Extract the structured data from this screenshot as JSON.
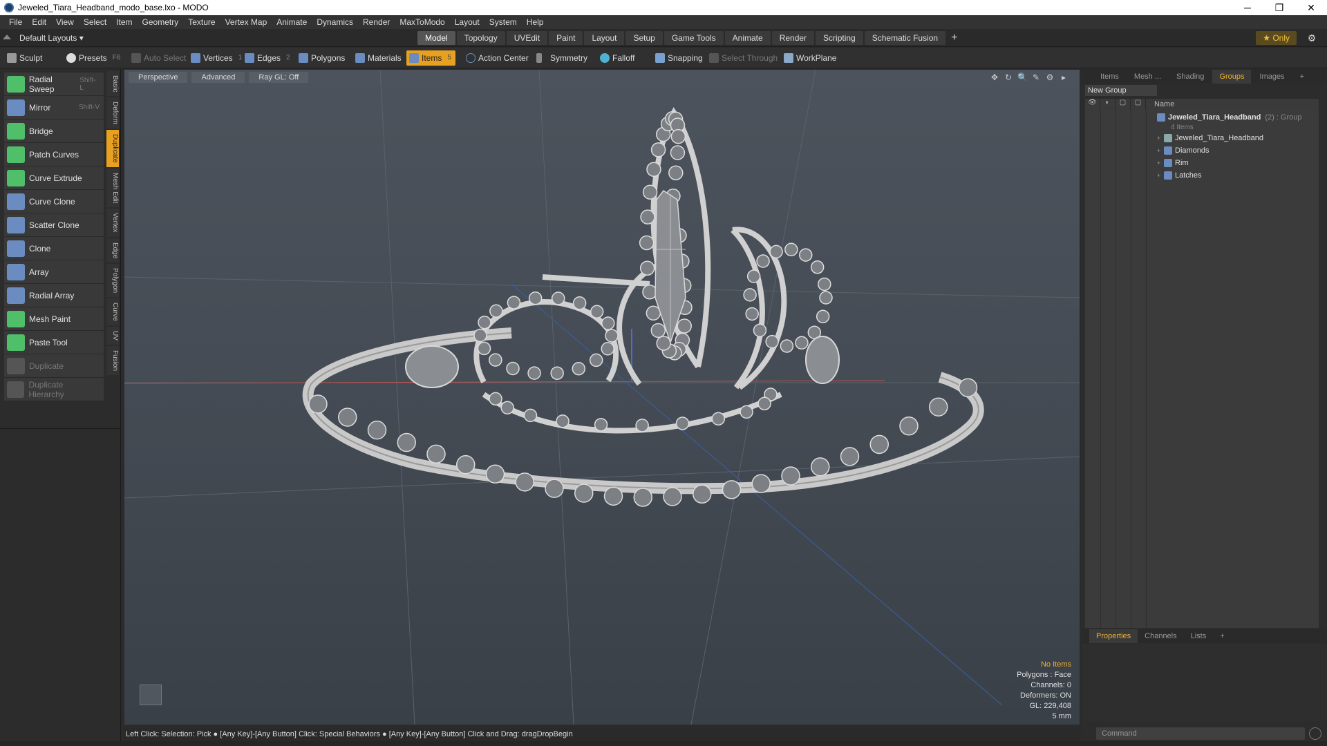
{
  "window": {
    "title": "Jeweled_Tiara_Headband_modo_base.lxo - MODO",
    "controls": [
      "─",
      "❐",
      "✕"
    ]
  },
  "menu": [
    "File",
    "Edit",
    "View",
    "Select",
    "Item",
    "Geometry",
    "Texture",
    "Vertex Map",
    "Animate",
    "Dynamics",
    "Render",
    "MaxToModo",
    "Layout",
    "System",
    "Help"
  ],
  "layout": {
    "selector": "Default Layouts ▾",
    "tabs": [
      "Model",
      "Topology",
      "UVEdit",
      "Paint",
      "Layout",
      "Setup",
      "Game Tools",
      "Animate",
      "Render",
      "Scripting",
      "Schematic Fusion"
    ],
    "active_tab": "Model",
    "plus": "+",
    "only": "★ Only",
    "gear": "⚙"
  },
  "toolbar": {
    "sculpt": "Sculpt",
    "presets": "Presets",
    "presets_key": "F6",
    "auto_select": "Auto Select",
    "vertices": "Vertices",
    "vertices_num": "1",
    "edges": "Edges",
    "edges_num": "2",
    "polygons": "Polygons",
    "materials": "Materials",
    "items": "Items",
    "items_num": "5",
    "action_center": "Action Center",
    "symmetry": "Symmetry",
    "falloff": "Falloff",
    "snapping": "Snapping",
    "select_through": "Select Through",
    "workplane": "WorkPlane"
  },
  "tools": [
    {
      "label": "Radial Sweep",
      "shortcut": "Shift-L",
      "color": "#4fbf6a"
    },
    {
      "label": "Mirror",
      "shortcut": "Shift-V",
      "color": "#6a8cc0"
    },
    {
      "label": "Bridge",
      "shortcut": "",
      "color": "#4fbf6a"
    },
    {
      "label": "Patch Curves",
      "shortcut": "",
      "color": "#4fbf6a"
    },
    {
      "label": "Curve Extrude",
      "shortcut": "",
      "color": "#4fbf6a"
    },
    {
      "label": "Curve Clone",
      "shortcut": "",
      "color": "#6a8cc0"
    },
    {
      "label": "Scatter Clone",
      "shortcut": "",
      "color": "#6a8cc0"
    },
    {
      "label": "Clone",
      "shortcut": "",
      "color": "#6a8cc0"
    },
    {
      "label": "Array",
      "shortcut": "",
      "color": "#6a8cc0"
    },
    {
      "label": "Radial Array",
      "shortcut": "",
      "color": "#6a8cc0"
    },
    {
      "label": "Mesh Paint",
      "shortcut": "",
      "color": "#4fbf6a"
    },
    {
      "label": "Paste Tool",
      "shortcut": "",
      "color": "#4fbf6a"
    },
    {
      "label": "Duplicate",
      "shortcut": "",
      "color": "#555",
      "dim": true
    },
    {
      "label": "Duplicate Hierarchy",
      "shortcut": "",
      "color": "#555",
      "dim": true
    }
  ],
  "side_tabs": [
    "Basic",
    "Deform",
    "Duplicate",
    "Mesh Edit",
    "Vertex",
    "Edge",
    "Polygon",
    "Curve",
    "UV",
    "Fusion"
  ],
  "active_side_tab": "Duplicate",
  "viewport": {
    "tabs": [
      "Perspective",
      "Advanced",
      "Ray GL: Off"
    ],
    "icons": [
      "✥",
      "↻",
      "🔍",
      "✎",
      "⚙",
      "▸"
    ],
    "info": {
      "no_items": "No Items",
      "polygons": "Polygons : Face",
      "channels": "Channels: 0",
      "deformers": "Deformers: ON",
      "gl": "GL: 229,408",
      "unit": "5 mm"
    }
  },
  "right": {
    "tabs": [
      "Items",
      "Mesh ...",
      "Shading",
      "Groups",
      "Images",
      "+"
    ],
    "active_tab": "Groups",
    "new_group": "New Group",
    "header_name": "Name",
    "group": {
      "name": "Jeweled_Tiara_Headband",
      "suffix": "(2) : Group",
      "count": "4 Items"
    },
    "children": [
      "Jeweled_Tiara_Headband",
      "Diamonds",
      "Rim",
      "Latches"
    ]
  },
  "props_tabs": [
    "Properties",
    "Channels",
    "Lists",
    "+"
  ],
  "command_placeholder": "Command",
  "status": "Left Click: Selection: Pick ● [Any Key]-[Any Button] Click: Special Behaviors ● [Any Key]-[Any Button] Click and Drag: dragDropBegin",
  "colors": {
    "accent": "#e8a020",
    "tab_active_text": "#f0b030",
    "viewport_top": "#4c535c"
  }
}
